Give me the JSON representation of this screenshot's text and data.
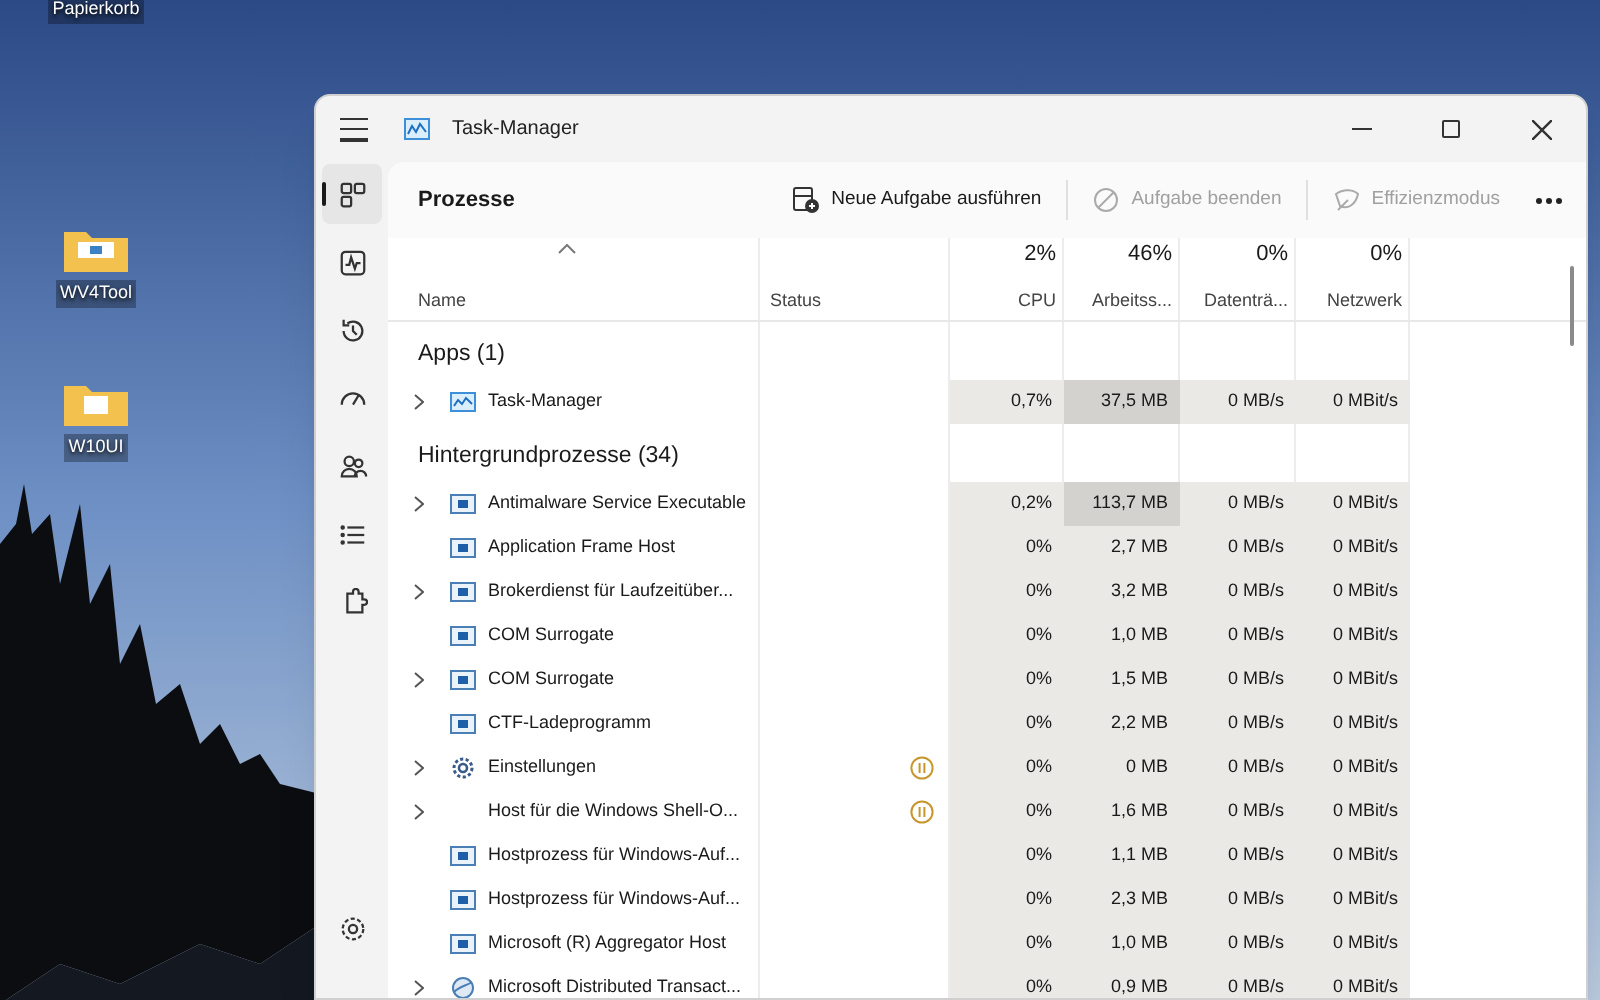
{
  "desktop": {
    "icons": [
      {
        "label": "Papierkorb",
        "kind": "bin"
      },
      {
        "label": "WV4Tool",
        "kind": "folder-app"
      },
      {
        "label": "W10UI",
        "kind": "folder-doc"
      }
    ]
  },
  "window": {
    "title": "Task-Manager"
  },
  "nav": {
    "items": [
      {
        "kind": "processes",
        "selected": true
      },
      {
        "kind": "performance",
        "selected": false
      },
      {
        "kind": "history",
        "selected": false
      },
      {
        "kind": "startup",
        "selected": false
      },
      {
        "kind": "users",
        "selected": false
      },
      {
        "kind": "details",
        "selected": false
      },
      {
        "kind": "services",
        "selected": false
      }
    ],
    "settings": {
      "kind": "settings",
      "selected": false
    }
  },
  "toolbar": {
    "title": "Prozesse",
    "actions": [
      {
        "label": "Neue Aufgabe ausführen",
        "kind": "new",
        "disabled": false
      },
      {
        "label": "Aufgabe beenden",
        "kind": "end",
        "disabled": true
      },
      {
        "label": "Effizienzmodus",
        "kind": "eco",
        "disabled": true
      }
    ]
  },
  "table": {
    "columns": [
      {
        "label": "Name"
      },
      {
        "label": "Status"
      },
      {
        "label": "CPU",
        "total": "2%"
      },
      {
        "label": "Arbeitss...",
        "total": "46%"
      },
      {
        "label": "Datenträ...",
        "total": "0%"
      },
      {
        "label": "Netzwerk",
        "total": "0%"
      }
    ],
    "groups": [
      {
        "title": "Apps (1)",
        "rows": [
          {
            "name": "Task-Manager",
            "kind": "graph",
            "expandable": true,
            "suspended": false,
            "cpu": "0,7%",
            "memory": "37,5 MB",
            "memory_high": true,
            "disk": "0 MB/s",
            "network": "0 MBit/s"
          }
        ]
      },
      {
        "title": "Hintergrundprozesse (34)",
        "rows": [
          {
            "name": "Antimalware Service Executable",
            "kind": "window",
            "expandable": true,
            "suspended": false,
            "cpu": "0,2%",
            "memory": "113,7 MB",
            "memory_high": true,
            "disk": "0 MB/s",
            "network": "0 MBit/s"
          },
          {
            "name": "Application Frame Host",
            "kind": "window",
            "expandable": false,
            "suspended": false,
            "cpu": "0%",
            "memory": "2,7 MB",
            "memory_high": false,
            "disk": "0 MB/s",
            "network": "0 MBit/s"
          },
          {
            "name": "Brokerdienst für Laufzeitüber...",
            "kind": "window",
            "expandable": true,
            "suspended": false,
            "cpu": "0%",
            "memory": "3,2 MB",
            "memory_high": false,
            "disk": "0 MB/s",
            "network": "0 MBit/s"
          },
          {
            "name": "COM Surrogate",
            "kind": "window",
            "expandable": false,
            "suspended": false,
            "cpu": "0%",
            "memory": "1,0 MB",
            "memory_high": false,
            "disk": "0 MB/s",
            "network": "0 MBit/s"
          },
          {
            "name": "COM Surrogate",
            "kind": "window",
            "expandable": true,
            "suspended": false,
            "cpu": "0%",
            "memory": "1,5 MB",
            "memory_high": false,
            "disk": "0 MB/s",
            "network": "0 MBit/s"
          },
          {
            "name": "CTF-Ladeprogramm",
            "kind": "window",
            "expandable": false,
            "suspended": false,
            "cpu": "0%",
            "memory": "2,2 MB",
            "memory_high": false,
            "disk": "0 MB/s",
            "network": "0 MBit/s"
          },
          {
            "name": "Einstellungen",
            "kind": "gear",
            "expandable": true,
            "suspended": true,
            "cpu": "0%",
            "memory": "0 MB",
            "memory_high": false,
            "disk": "0 MB/s",
            "network": "0 MBit/s"
          },
          {
            "name": "Host für die Windows Shell-O...",
            "kind": "plain",
            "expandable": true,
            "suspended": true,
            "cpu": "0%",
            "memory": "1,6 MB",
            "memory_high": false,
            "disk": "0 MB/s",
            "network": "0 MBit/s"
          },
          {
            "name": "Hostprozess für Windows-Auf...",
            "kind": "window",
            "expandable": false,
            "suspended": false,
            "cpu": "0%",
            "memory": "1,1 MB",
            "memory_high": false,
            "disk": "0 MB/s",
            "network": "0 MBit/s"
          },
          {
            "name": "Hostprozess für Windows-Auf...",
            "kind": "window",
            "expandable": false,
            "suspended": false,
            "cpu": "0%",
            "memory": "2,3 MB",
            "memory_high": false,
            "disk": "0 MB/s",
            "network": "0 MBit/s"
          },
          {
            "name": "Microsoft (R) Aggregator Host",
            "kind": "window",
            "expandable": false,
            "suspended": false,
            "cpu": "0%",
            "memory": "1,0 MB",
            "memory_high": false,
            "disk": "0 MB/s",
            "network": "0 MBit/s"
          },
          {
            "name": "Microsoft Distributed Transact...",
            "kind": "globe",
            "expandable": true,
            "suspended": false,
            "cpu": "0%",
            "memory": "0,9 MB",
            "memory_high": false,
            "disk": "0 MB/s",
            "network": "0 MBit/s"
          }
        ]
      }
    ]
  }
}
